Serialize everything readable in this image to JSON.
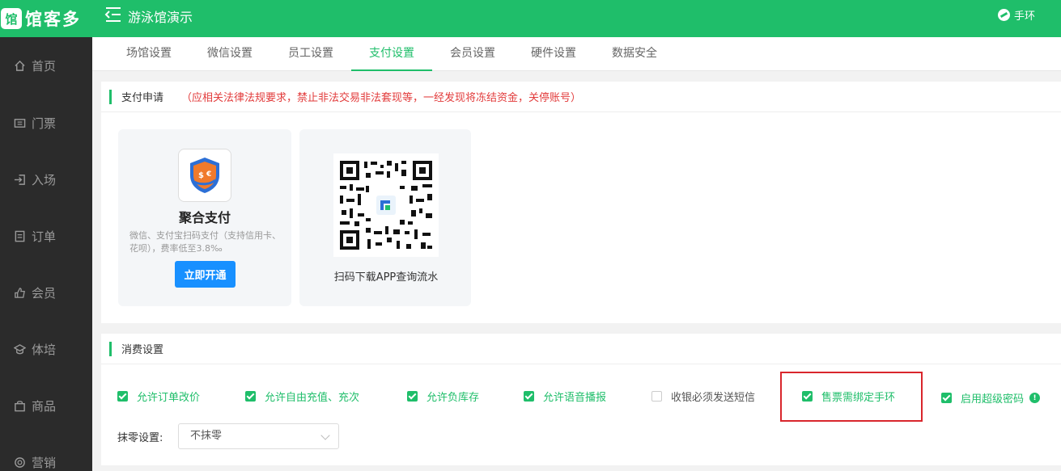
{
  "app": {
    "logo_mark": "馆",
    "logo_text": "馆客多",
    "venue_title": "游泳馆演示",
    "wristband_label": "手环",
    "brand_color": "#1fbe6a"
  },
  "sidebar": {
    "items": [
      {
        "label": "首页",
        "icon": "home-icon"
      },
      {
        "label": "门票",
        "icon": "ticket-icon"
      },
      {
        "label": "入场",
        "icon": "entry-icon"
      },
      {
        "label": "订单",
        "icon": "order-icon"
      },
      {
        "label": "会员",
        "icon": "member-icon"
      },
      {
        "label": "体培",
        "icon": "training-icon"
      },
      {
        "label": "商品",
        "icon": "goods-icon"
      },
      {
        "label": "营销",
        "icon": "marketing-icon"
      }
    ]
  },
  "tabs": {
    "items": [
      {
        "label": "场馆设置"
      },
      {
        "label": "微信设置"
      },
      {
        "label": "员工设置"
      },
      {
        "label": "支付设置",
        "active": true
      },
      {
        "label": "会员设置"
      },
      {
        "label": "硬件设置"
      },
      {
        "label": "数据安全"
      }
    ]
  },
  "payment": {
    "title": "支付申请",
    "warning": "（应相关法律法规要求，禁止非法交易非法套现等，一经发现将冻结资金，关停账号）",
    "card": {
      "title": "聚合支付",
      "description": "微信、支付宝扫码支付（支持信用卡、花呗），费率低至3.8‰",
      "button": "立即开通"
    },
    "qr_caption": "扫码下载APP查询流水"
  },
  "consumption": {
    "title": "消费设置",
    "options": [
      {
        "label": "允许订单改价",
        "checked": true
      },
      {
        "label": "允许自由充值、充次",
        "checked": true
      },
      {
        "label": "允许负库存",
        "checked": true
      },
      {
        "label": "允许语音播报",
        "checked": true
      },
      {
        "label": "收银必须发送短信",
        "checked": false
      },
      {
        "label": "售票需绑定手环",
        "checked": true
      },
      {
        "label": "启用超级密码",
        "checked": true
      }
    ],
    "info_mark": "!",
    "rounding_label": "抹零设置:",
    "rounding_value": "不抹零"
  }
}
